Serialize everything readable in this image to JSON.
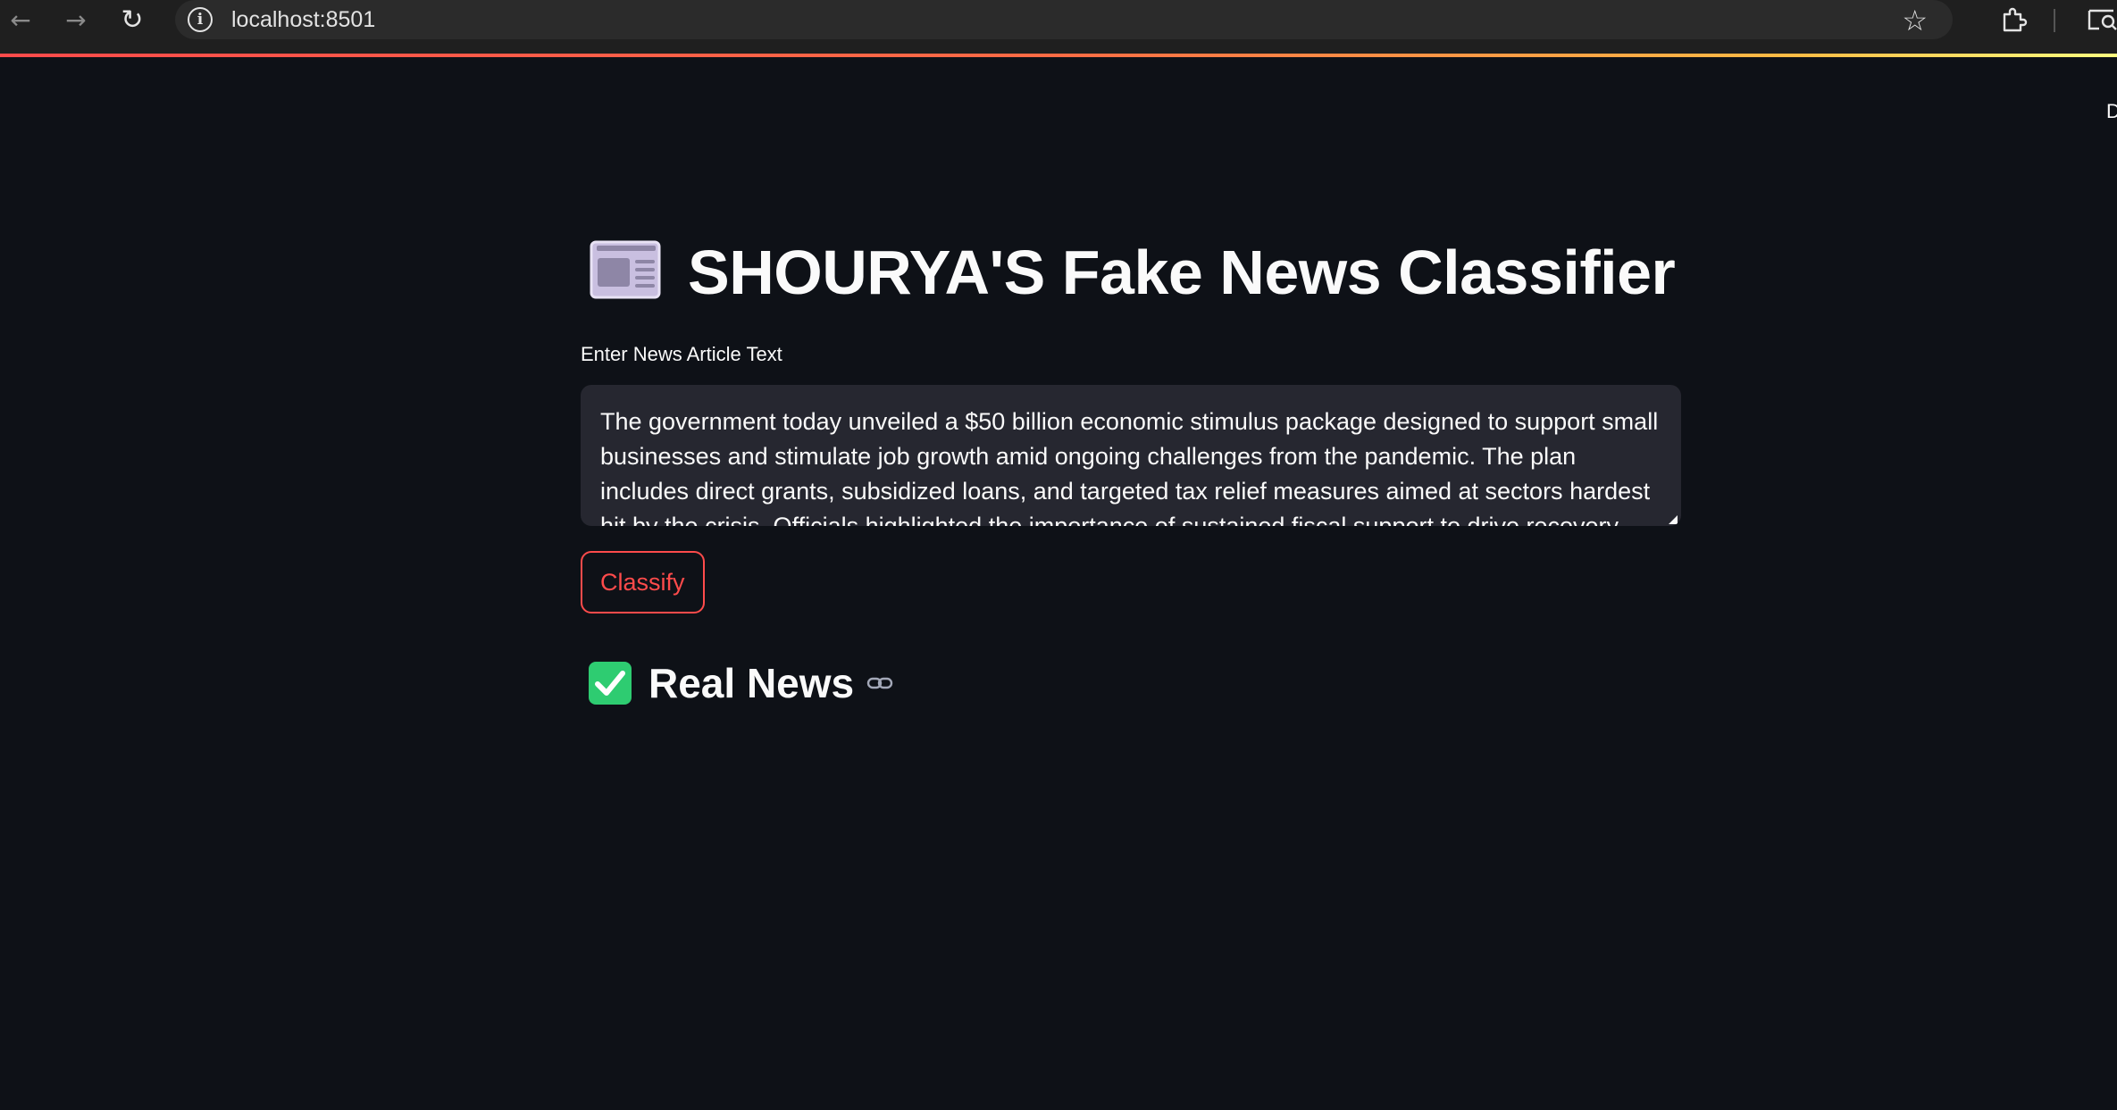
{
  "browser": {
    "url": "localhost:8501",
    "back_icon": "arrow-left-icon",
    "forward_icon": "arrow-right-icon",
    "reload_icon": "reload-icon",
    "info_icon": "info-icon",
    "bookmark_icon": "star-icon",
    "extensions_icon": "puzzle-icon",
    "cast_icon": "search-window-icon",
    "loading_bar_colors": [
      "#ff4b4b",
      "#ffbd45",
      "#fffd80"
    ]
  },
  "app": {
    "title_emoji_icon": "newspaper-icon",
    "title": "SHOURYA'S Fake News Classifier",
    "text_input": {
      "label": "Enter News Article Text",
      "value": "The government today unveiled a $50 billion economic stimulus package designed to support small businesses and stimulate job growth amid ongoing challenges from the pandemic. The plan includes direct grants, subsidized loans, and targeted tax relief measures aimed at sectors hardest hit by the crisis. Officials highlighted the importance of sustained fiscal support to drive recovery and foster"
    },
    "classify_button": {
      "label": "Classify"
    },
    "result": {
      "icon": "check-mark-icon",
      "label": "Real News",
      "anchor_icon": "link-icon"
    },
    "colors": {
      "background": "#0e1117",
      "input_background": "#262730",
      "accent": "#ff4b4b",
      "success": "#2ecc71",
      "text": "#fafafa"
    }
  }
}
